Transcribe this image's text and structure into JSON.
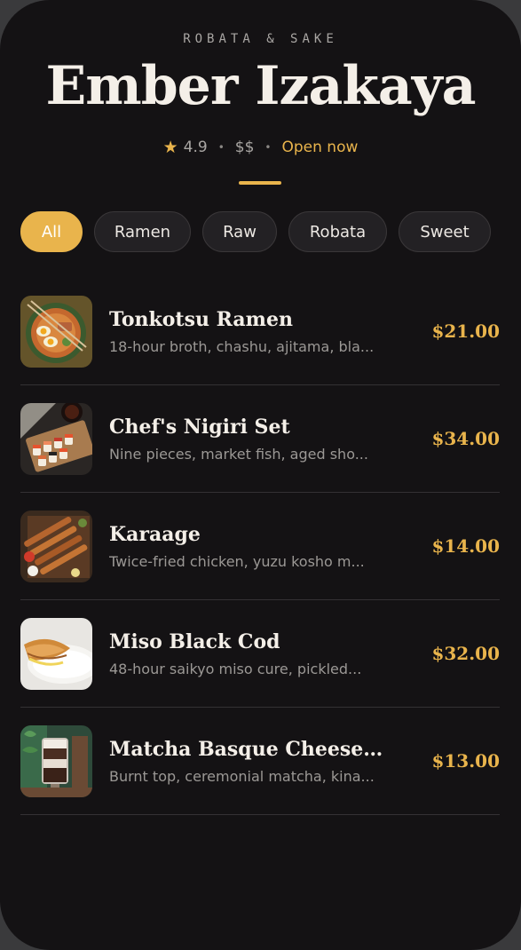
{
  "header": {
    "kicker": "ROBATA & SAKE",
    "title": "Ember Izakaya",
    "rating": "4.9",
    "price_level": "$$",
    "status": "Open now"
  },
  "filters": [
    {
      "label": "All",
      "active": true
    },
    {
      "label": "Ramen",
      "active": false
    },
    {
      "label": "Raw",
      "active": false
    },
    {
      "label": "Robata",
      "active": false
    },
    {
      "label": "Sweet",
      "active": false
    }
  ],
  "menu": [
    {
      "name": "Tonkotsu Ramen",
      "desc": "18-hour broth, chashu, ajitama, bla...",
      "price": "$21.00",
      "image": "ramen-bowl"
    },
    {
      "name": "Chef's Nigiri Set",
      "desc": "Nine pieces, market fish, aged sho...",
      "price": "$34.00",
      "image": "sushi-board"
    },
    {
      "name": "Karaage",
      "desc": "Twice-fried chicken, yuzu kosho m...",
      "price": "$14.00",
      "image": "skewers-platter"
    },
    {
      "name": "Miso Black Cod",
      "desc": "48-hour saikyo miso cure, pickled...",
      "price": "$32.00",
      "image": "fish-plate"
    },
    {
      "name": "Matcha Basque Cheesec...",
      "desc": "Burnt top, ceremonial matcha, kina...",
      "price": "$13.00",
      "image": "dessert-glass"
    }
  ],
  "colors": {
    "accent": "#e9b44c",
    "background": "#141214",
    "text": "#f4efe8"
  }
}
